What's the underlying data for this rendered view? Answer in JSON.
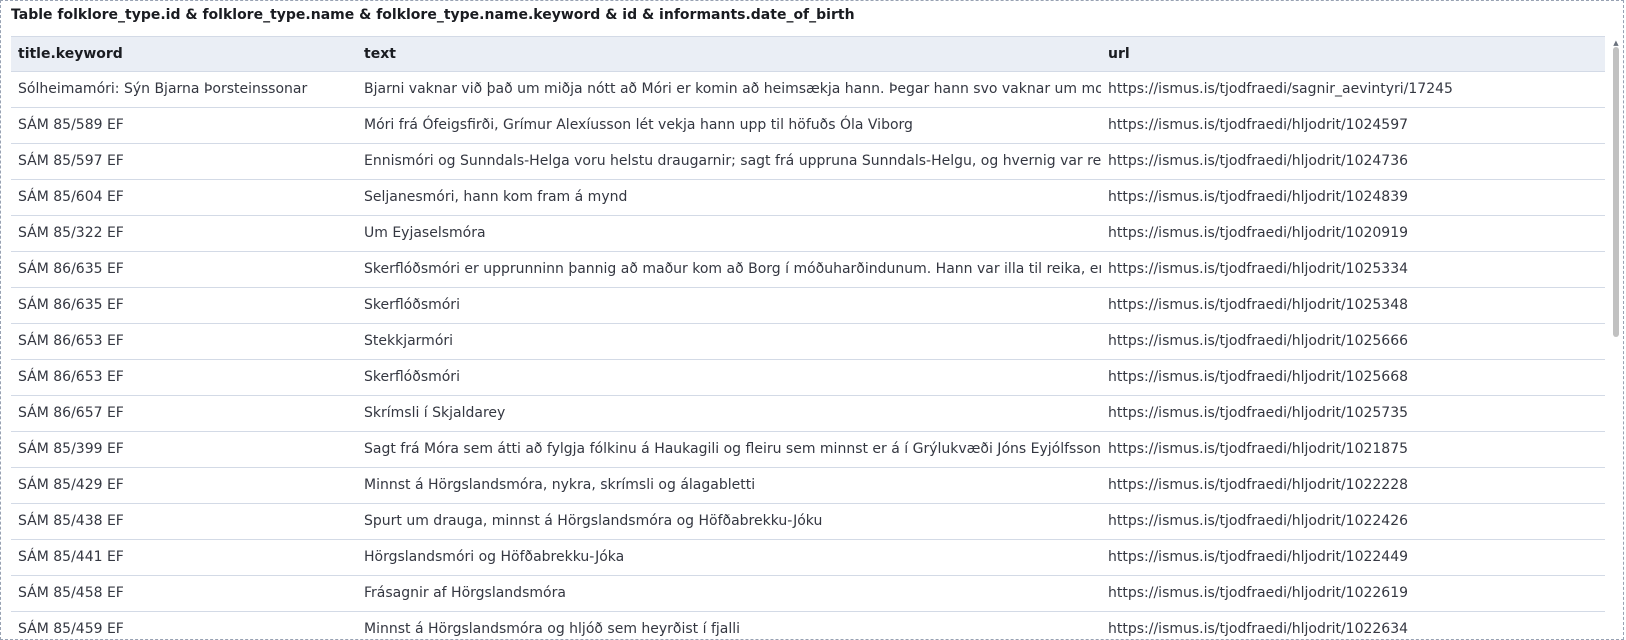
{
  "panel": {
    "title": "Table folklore_type.id & folklore_type.name & folklore_type.name.keyword & id & informants.date_of_birth"
  },
  "table": {
    "columns": [
      "title.keyword",
      "text",
      "url"
    ],
    "rows": [
      [
        "Sólheimamóri: Sýn Bjarna Þorsteinssonar",
        "Bjarni vaknar við það um miðja nótt að Móri er komin að heimsækja hann. Þegar hann svo vaknar um morguninn",
        "https://ismus.is/tjodfraedi/sagnir_aevintyri/17245"
      ],
      [
        "SÁM 85/589 EF",
        "Móri frá Ófeigsfirði, Grímur Alexíusson lét vekja hann upp til höfuðs Óla Viborg",
        "https://ismus.is/tjodfraedi/hljodrit/1024597"
      ],
      [
        "SÁM 85/597 EF",
        "Ennismóri og Sunndals-Helga voru helstu draugarnir; sagt frá uppruna Sunndals-Helgu, og hvernig var reynt v",
        "https://ismus.is/tjodfraedi/hljodrit/1024736"
      ],
      [
        "SÁM 85/604 EF",
        "Seljanesmóri, hann kom fram á mynd",
        "https://ismus.is/tjodfraedi/hljodrit/1024839"
      ],
      [
        "SÁM 85/322 EF",
        "Um Eyjaselsmóra",
        "https://ismus.is/tjodfraedi/hljodrit/1020919"
      ],
      [
        "SÁM 86/635 EF",
        "Skerflóðsmóri er upprunninn þannig að maður kom að Borg í móðuharðindunum. Hann var illa til reika, en bóndi",
        "https://ismus.is/tjodfraedi/hljodrit/1025334"
      ],
      [
        "SÁM 86/635 EF",
        "Skerflóðsmóri",
        "https://ismus.is/tjodfraedi/hljodrit/1025348"
      ],
      [
        "SÁM 86/653 EF",
        "Stekkjarmóri",
        "https://ismus.is/tjodfraedi/hljodrit/1025666"
      ],
      [
        "SÁM 86/653 EF",
        "Skerflóðsmóri",
        "https://ismus.is/tjodfraedi/hljodrit/1025668"
      ],
      [
        "SÁM 86/657 EF",
        "Skrímsli í Skjaldarey",
        "https://ismus.is/tjodfraedi/hljodrit/1025735"
      ],
      [
        "SÁM 85/399 EF",
        "Sagt frá Móra sem átti að fylgja fólkinu á Haukagili og fleiru sem minnst er á í Grýlukvæði Jóns Eyjólfssonar; sa",
        "https://ismus.is/tjodfraedi/hljodrit/1021875"
      ],
      [
        "SÁM 85/429 EF",
        "Minnst á Hörgslandsmóra, nykra, skrímsli og álagabletti",
        "https://ismus.is/tjodfraedi/hljodrit/1022228"
      ],
      [
        "SÁM 85/438 EF",
        "Spurt um drauga, minnst á Hörgslandsmóra og Höfðabrekku-Jóku",
        "https://ismus.is/tjodfraedi/hljodrit/1022426"
      ],
      [
        "SÁM 85/441 EF",
        "Hörgslandsmóri og Höfðabrekku-Jóka",
        "https://ismus.is/tjodfraedi/hljodrit/1022449"
      ],
      [
        "SÁM 85/458 EF",
        "Frásagnir af Hörgslandsmóra",
        "https://ismus.is/tjodfraedi/hljodrit/1022619"
      ],
      [
        "SÁM 85/459 EF",
        "Minnst á Hörgslandsmóra og hljóð sem heyrðist í fjalli",
        "https://ismus.is/tjodfraedi/hljodrit/1022634"
      ]
    ]
  },
  "scrollbar": {
    "up_arrow_icon": "chevron-up-icon",
    "position": 0.0
  }
}
